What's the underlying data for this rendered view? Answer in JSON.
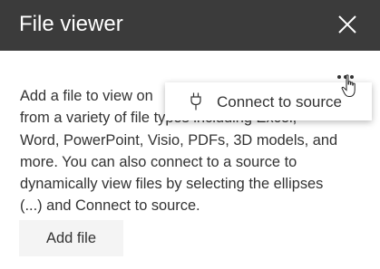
{
  "header": {
    "title": "File viewer",
    "close_icon": "close-icon",
    "background_color": "#3b3b3b"
  },
  "description": {
    "lines": [
      "Add a file to view on",
      "from a variety of file types including Excel,",
      "Word, PowerPoint, Visio, PDFs, 3D models, and",
      "more. You can also connect to a source to",
      "dynamically view files by selecting the ellipses",
      "(...) and Connect to source."
    ]
  },
  "more_menu": {
    "icon": "more-options-icon",
    "items": [
      {
        "label": "Connect to source",
        "icon": "plug-icon"
      }
    ]
  },
  "cursor": {
    "icon": "hand-pointer-icon"
  },
  "actions": {
    "add_file_label": "Add file"
  }
}
